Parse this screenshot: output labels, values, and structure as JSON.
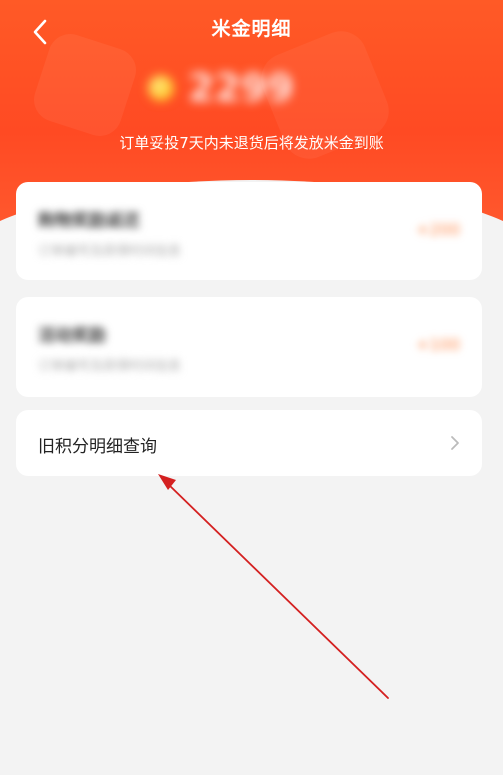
{
  "header": {
    "title": "米金明细",
    "back_icon": "chevron-left-icon",
    "balance_value": "2299",
    "notice": "订单妥投7天内未退货后将发放米金到账"
  },
  "records": [
    {
      "title": "购物奖励返还",
      "subtitle": "订单编号及获得时间信息",
      "amount": "+200"
    },
    {
      "title": "活动奖励",
      "subtitle": "订单编号及获得时间信息",
      "amount": "+100"
    }
  ],
  "history_link": {
    "label": "旧积分明细查询",
    "icon": "chevron-right-icon"
  },
  "colors": {
    "header": "#ff4a23",
    "background": "#f3f3f3",
    "card": "#ffffff",
    "annotation": "#d42020"
  }
}
